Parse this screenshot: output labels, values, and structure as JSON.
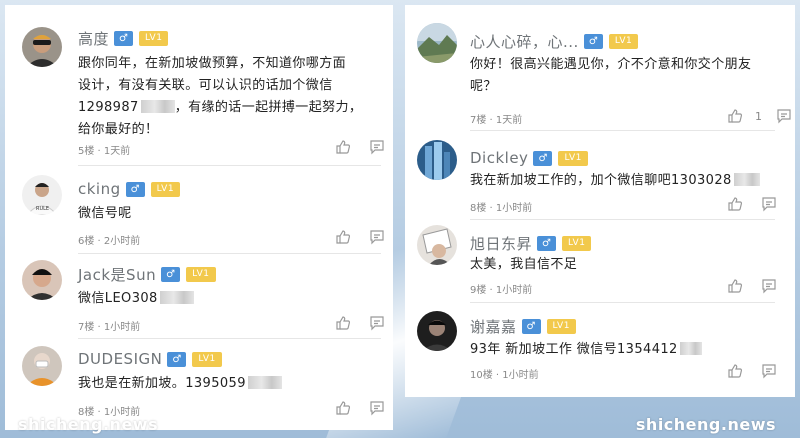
{
  "left_comments": [
    {
      "username": "高度",
      "gender_symbol": "♂",
      "level": "LV1",
      "lines": [
        "跟你同年，在新加坡做预算，不知道你哪方面",
        "设计，有没有关联。可以认识的话加个微信",
        "1298987",
        "，有缘的话一起拼搏一起努力，",
        "给你最好的！"
      ],
      "floor": "5楼",
      "time": "1天前"
    },
    {
      "username": "cking",
      "gender_symbol": "♂",
      "level": "LV1",
      "text": "微信号呢",
      "floor": "6楼",
      "time": "2小时前"
    },
    {
      "username": "Jack是Sun",
      "gender_symbol": "♂",
      "level": "LV1",
      "text": "微信LEO308",
      "floor": "7楼",
      "time": "1小时前"
    },
    {
      "username": "DUDESIGN",
      "gender_symbol": "♂",
      "level": "LV1",
      "text": "我也是在新加坡。1395059",
      "floor": "8楼",
      "time": "1小时前"
    }
  ],
  "right_comments": [
    {
      "username": "心人心碎，心...",
      "gender_symbol": "♂",
      "level": "LV1",
      "lines": [
        "你好！很高兴能遇见你，介不介意和你交个朋友",
        "呢？"
      ],
      "floor": "7楼",
      "time": "1天前",
      "likes": "1"
    },
    {
      "username": "Dickley",
      "gender_symbol": "♂",
      "level": "LV1",
      "text": "我在新加坡工作的，加个微信聊吧1303028",
      "floor": "8楼",
      "time": "1小时前"
    },
    {
      "username": "旭日东昇",
      "gender_symbol": "♂",
      "level": "LV1",
      "text": "太美，我自信不足",
      "floor": "9楼",
      "time": "1小时前"
    },
    {
      "username": "谢嘉嘉",
      "gender_symbol": "♂",
      "level": "LV1",
      "text": "93年 新加坡工作 微信号1354412",
      "floor": "10楼",
      "time": "1小时前"
    }
  ],
  "watermark": "shicheng.news",
  "colors": {
    "gender_badge": "#4a90d8",
    "level_badge": "#f2c94c",
    "username": "#6f7478",
    "meta": "#888888"
  },
  "icons": {
    "like": "thumbs-up-icon",
    "reply": "comment-icon"
  }
}
